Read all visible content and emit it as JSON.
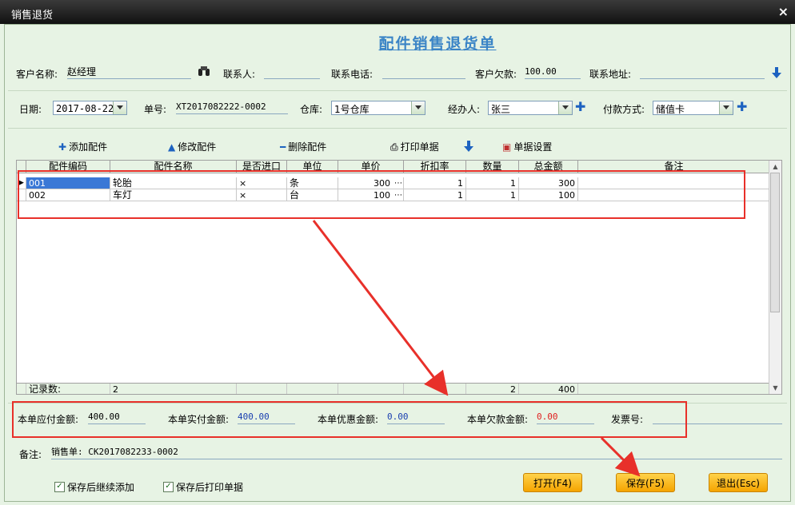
{
  "window": {
    "title": "销售退货",
    "close_glyph": "×"
  },
  "form_title": "配件销售退货单",
  "row1": {
    "customer_label": "客户名称:",
    "customer_value": "赵经理",
    "contact_label": "联系人:",
    "contact_value": "",
    "phone_label": "联系电话:",
    "phone_value": "",
    "debt_label": "客户欠款:",
    "debt_value": "100.00",
    "address_label": "联系地址:",
    "address_value": ""
  },
  "row2": {
    "date_label": "日期:",
    "date_value": "2017-08-22",
    "number_label": "单号:",
    "number_value": "XT2017082222-0002",
    "warehouse_label": "仓库:",
    "warehouse_value": "1号仓库",
    "handler_label": "经办人:",
    "handler_value": "张三",
    "payment_label": "付款方式:",
    "payment_value": "储值卡"
  },
  "toolbar": {
    "add": "添加配件",
    "edit": "修改配件",
    "delete": "删除配件",
    "print": "打印单据",
    "settings": "单据设置"
  },
  "table": {
    "columns": [
      "配件编码",
      "配件名称",
      "是否进口",
      "单位",
      "单价",
      "折扣率",
      "数量",
      "总金额",
      "备注"
    ],
    "rows": [
      {
        "code": "001",
        "name": "轮胎",
        "imported": "×",
        "unit": "条",
        "price": "300",
        "discount": "1",
        "qty": "1",
        "total": "300",
        "note": ""
      },
      {
        "code": "002",
        "name": "车灯",
        "imported": "×",
        "unit": "台",
        "price": "100",
        "discount": "1",
        "qty": "1",
        "total": "100",
        "note": ""
      }
    ],
    "footer": {
      "label": "记录数:",
      "count": "2",
      "qty_total": "2",
      "amount_total": "400"
    }
  },
  "summary": {
    "payable_label": "本单应付金额:",
    "payable_value": "400.00",
    "paid_label": "本单实付金额:",
    "paid_value": "400.00",
    "discount_label": "本单优惠金额:",
    "discount_value": "0.00",
    "owed_label": "本单欠款金额:",
    "owed_value": "0.00",
    "invoice_label": "发票号:",
    "invoice_value": ""
  },
  "remarks": {
    "label": "备注:",
    "value": "销售单: CK2017082233-0002"
  },
  "options": {
    "continue_add": "保存后继续添加",
    "print_after": "保存后打印单据"
  },
  "buttons": {
    "open": "打开(F4)",
    "save": "保存(F5)",
    "exit": "退出(Esc)"
  },
  "colors": {
    "accent": "#3a84c6",
    "annotation": "#e8302a",
    "button": "#f5a400",
    "paid_value": "#1a3fb0",
    "owed_value": "#e02020"
  }
}
